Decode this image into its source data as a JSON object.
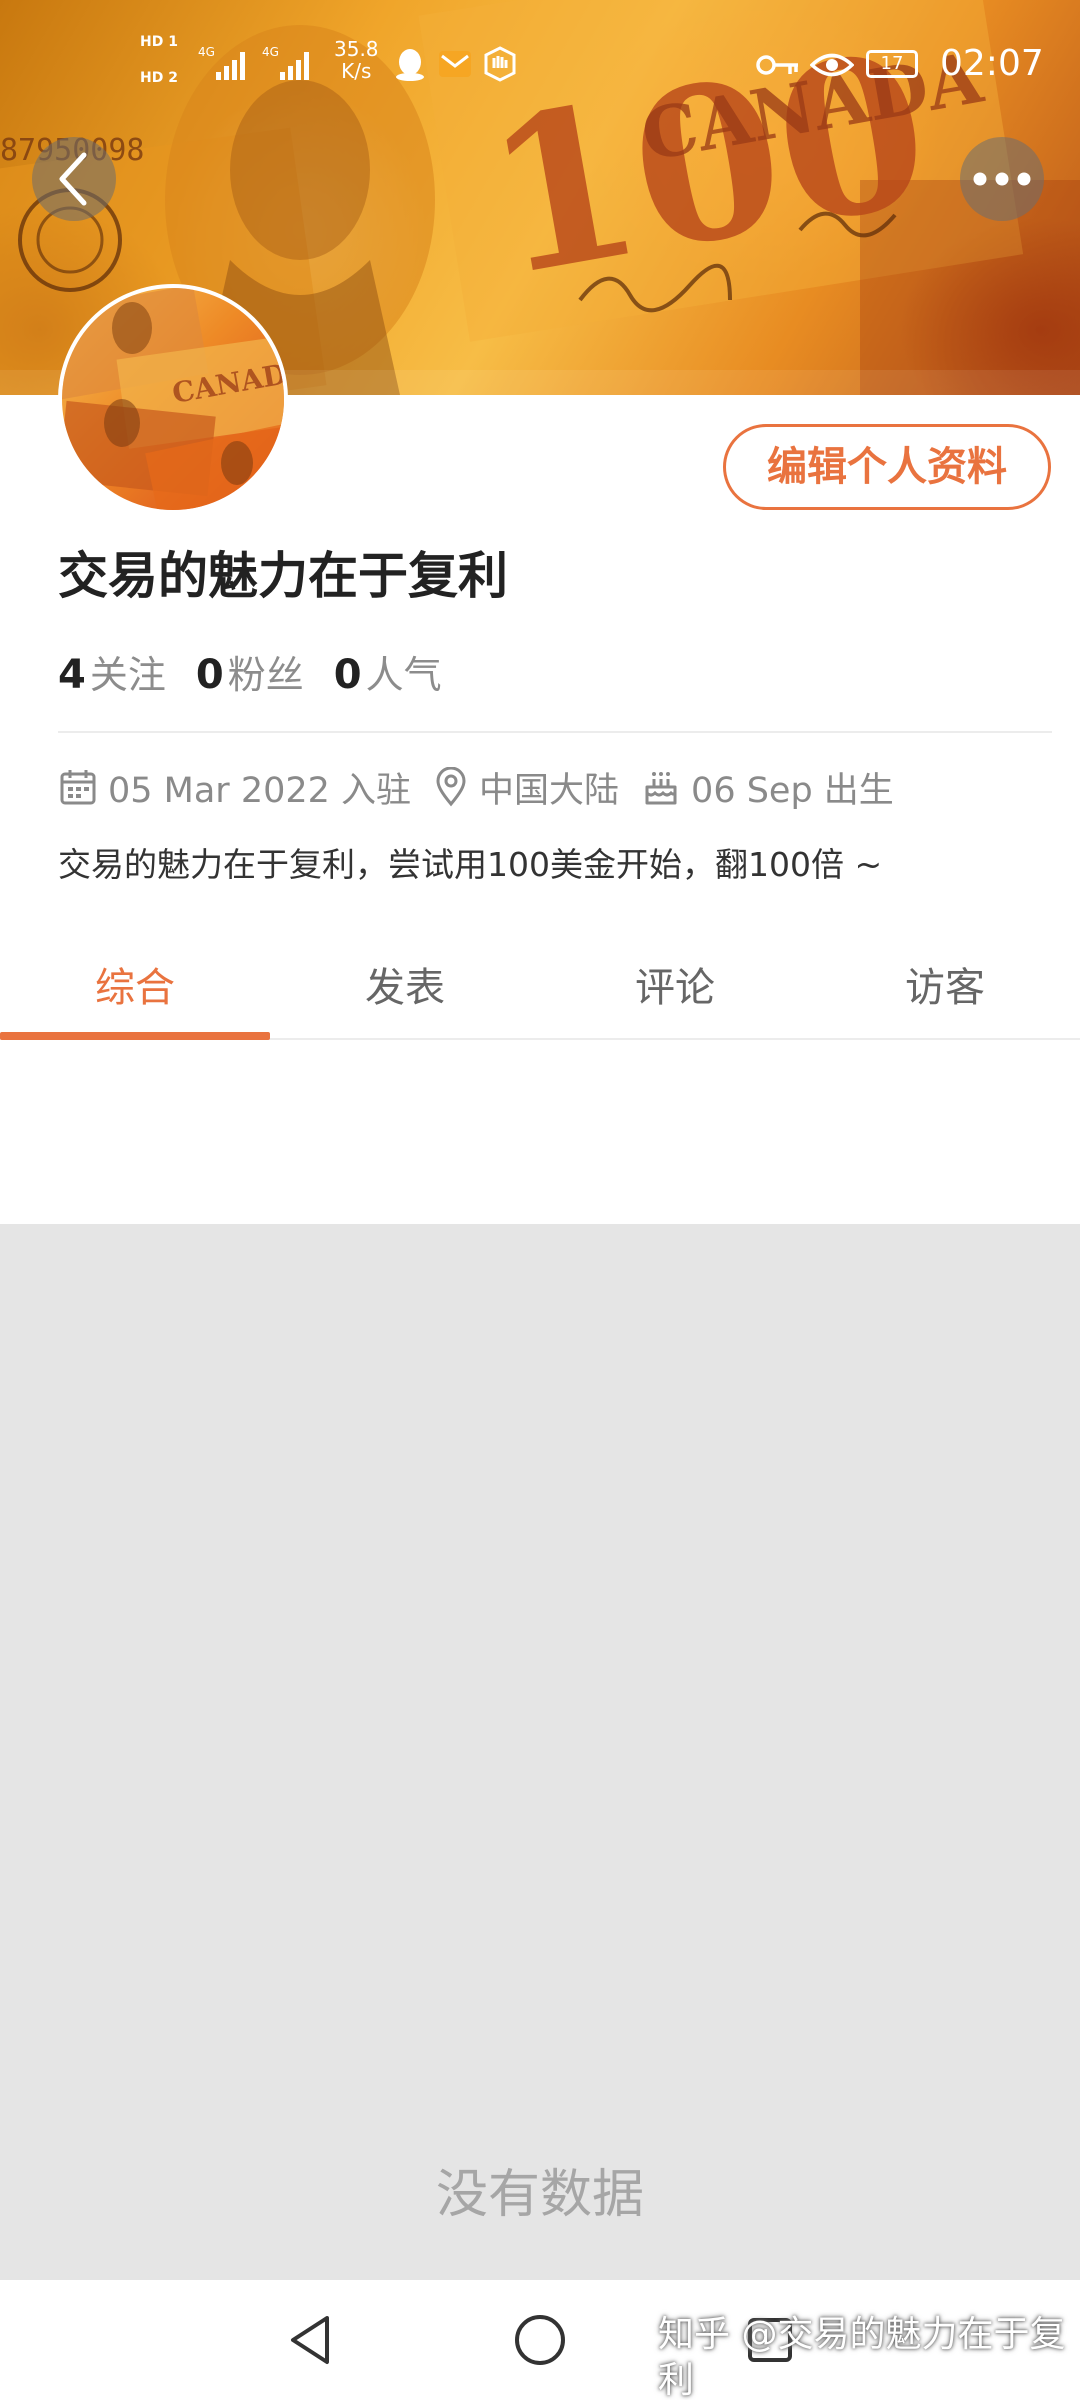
{
  "status_bar": {
    "sim1": "HD 1",
    "sim2": "HD 2",
    "network_label": "4G",
    "speed_value": "35.8",
    "speed_unit": "K/s",
    "battery_level": "17",
    "time": "02:07"
  },
  "banner_texts": {
    "big_number": "100",
    "country": "CANADA",
    "serial": "87950098"
  },
  "profile": {
    "username": "交易的魅力在于复利",
    "edit_button": "编辑个人资料",
    "stats": [
      {
        "num": "4",
        "label": "关注"
      },
      {
        "num": "0",
        "label": "粉丝"
      },
      {
        "num": "0",
        "label": "人气"
      }
    ],
    "meta": {
      "joined": "05 Mar 2022 入驻",
      "location": "中国大陆",
      "birthday": "06 Sep 出生"
    },
    "bio": "交易的魅力在于复利，尝试用100美金开始，翻100倍 ~"
  },
  "tabs": [
    {
      "label": "综合",
      "active": true
    },
    {
      "label": "发表",
      "active": false
    },
    {
      "label": "评论",
      "active": false
    },
    {
      "label": "访客",
      "active": false
    }
  ],
  "empty_state": "没有数据",
  "watermark": "知乎 @交易的魅力在于复利",
  "colors": {
    "accent": "#e9733f",
    "empty_bg": "#e5e5e5",
    "muted_text": "#8a8a8a"
  },
  "icons": {
    "back": "chevron-left-icon",
    "more": "more-horizontal-icon",
    "calendar": "calendar-icon",
    "location": "location-pin-icon",
    "birthday": "cake-icon",
    "nav_back": "triangle-back-icon",
    "nav_home": "circle-home-icon",
    "nav_recent": "square-recent-icon"
  }
}
